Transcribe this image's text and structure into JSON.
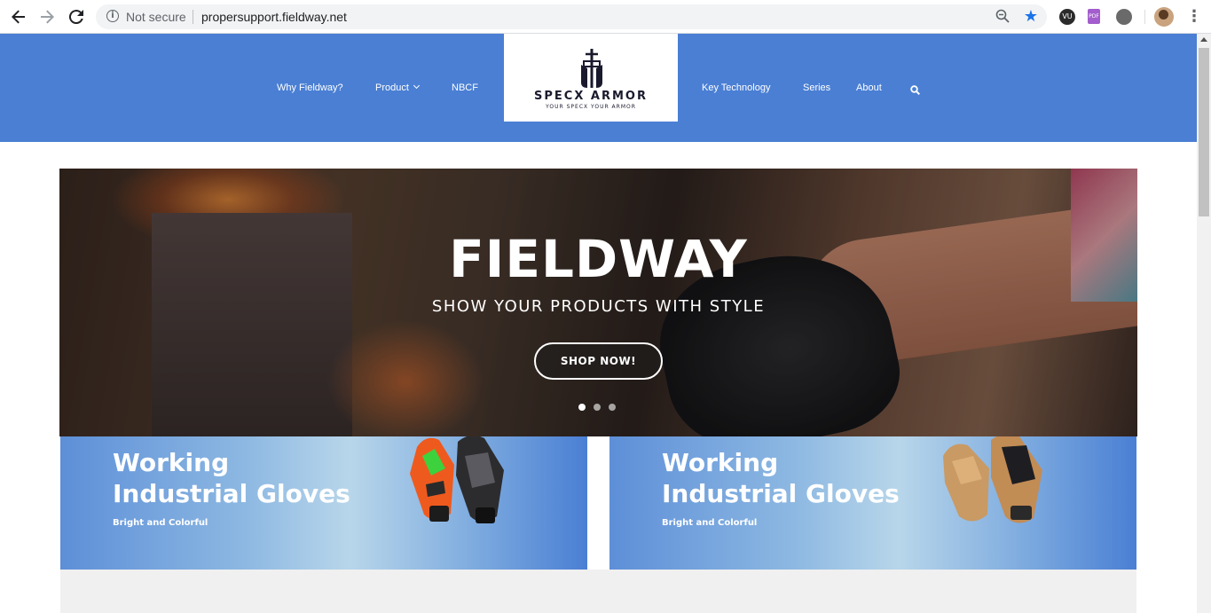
{
  "browser": {
    "security_label": "Not secure",
    "url": "propersupport.fieldway.net",
    "ext1": "VU",
    "ext2": "PDF"
  },
  "site": {
    "menu": {
      "why": "Why Fieldway?",
      "product": "Product",
      "nbcf": "NBCF",
      "key_tech": "Key Technology",
      "series": "Series",
      "about": "About"
    },
    "logo": {
      "name": "SPECX ARMOR",
      "tagline": "YOUR SPECX YOUR ARMOR"
    }
  },
  "hero": {
    "title": "FIELDWAY",
    "subtitle": "SHOW YOUR PRODUCTS WITH STYLE",
    "button": "SHOP NOW!",
    "slides": 3,
    "active_slide": 1
  },
  "promos": [
    {
      "title_line1": "Working",
      "title_line2": "Industrial Gloves",
      "subtitle": "Bright and Colorful"
    },
    {
      "title_line1": "Working",
      "title_line2": "Industrial Gloves",
      "subtitle": "Bright and Colorful"
    }
  ],
  "colors": {
    "header_blue": "#4a7fd4",
    "chrome_star": "#1a73e8"
  }
}
